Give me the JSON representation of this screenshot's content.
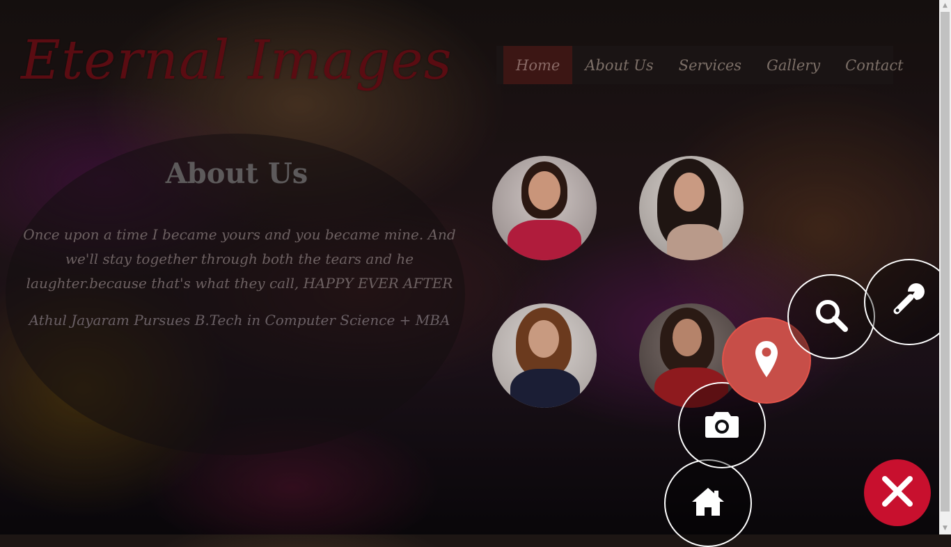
{
  "site": {
    "logo_text": "Eternal Images"
  },
  "nav": {
    "items": [
      {
        "label": "Home",
        "active": true
      },
      {
        "label": "About Us",
        "active": false
      },
      {
        "label": "Services",
        "active": false
      },
      {
        "label": "Gallery",
        "active": false
      },
      {
        "label": "Contact",
        "active": false
      }
    ]
  },
  "about": {
    "title": "About Us",
    "text": "Once upon a time I became yours and you became mine. And we'll stay together through both the tears and he laughter.because that's what they call, HAPPY EVER AFTER",
    "subtitle": "Athul Jayaram Pursues B.Tech in Computer Science + MBA"
  },
  "gallery": {
    "photos": [
      {
        "name": "photo-1"
      },
      {
        "name": "photo-2"
      },
      {
        "name": "photo-3"
      },
      {
        "name": "photo-4"
      }
    ]
  },
  "fab_menu": {
    "items": [
      {
        "icon": "home-icon"
      },
      {
        "icon": "camera-icon"
      },
      {
        "icon": "map-pin-icon",
        "active": true
      },
      {
        "icon": "search-icon"
      },
      {
        "icon": "wrench-icon"
      }
    ],
    "close_icon": "close-icon",
    "accent_color": "#c74e48",
    "close_color": "#c8102e"
  }
}
